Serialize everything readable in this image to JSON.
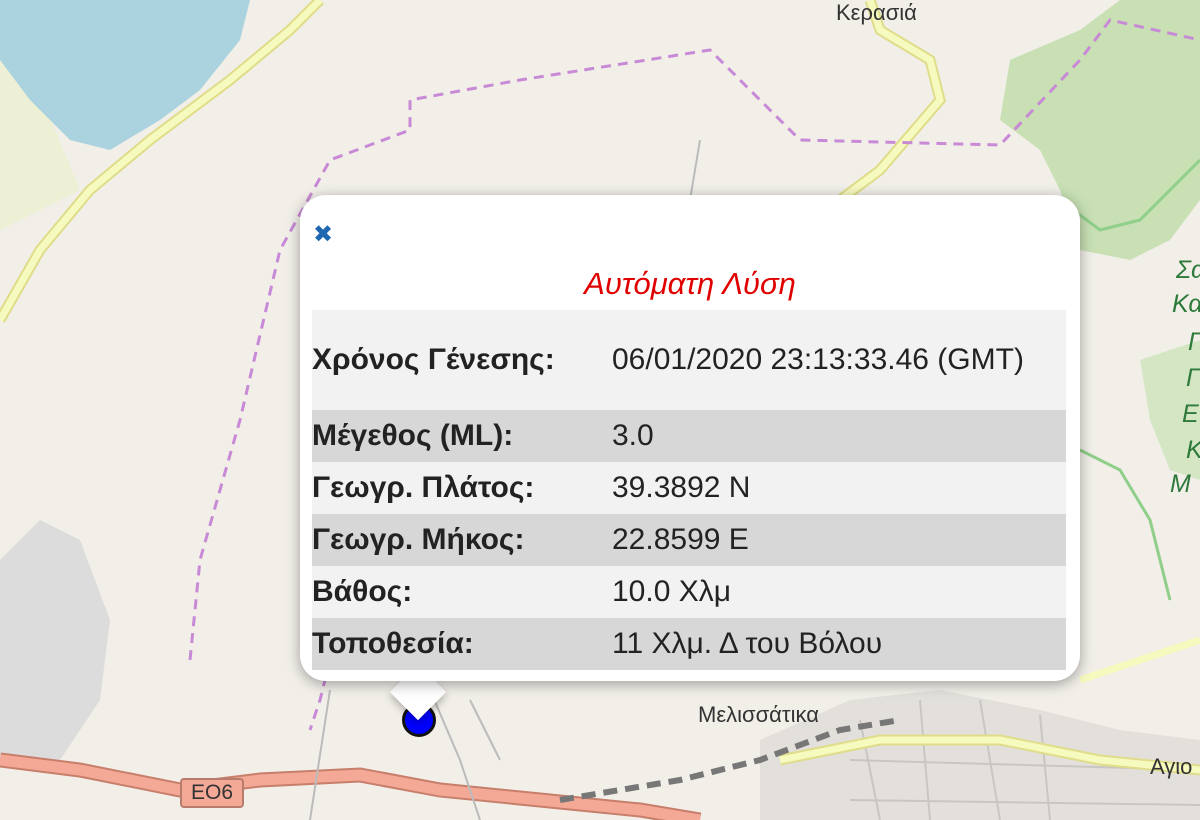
{
  "map": {
    "place_labels": {
      "kerasia": "Κερασιά",
      "melissatika": "Μελισσάτικα",
      "agi": "Αγιο"
    },
    "green_labels": [
      "Σα",
      "Κα",
      "Γ",
      "Γ",
      "Ε",
      "Κ",
      "Μ"
    ],
    "road_shield": "EO6",
    "colors": {
      "land": "#f2efe9",
      "water": "#aad3df",
      "forest": "#c8e0b4",
      "major_road": "#f7fabf",
      "motorway": "#f3a996",
      "boundary": "#c88ad6",
      "marker": "#0000ff"
    }
  },
  "popup": {
    "close_symbol": "✖",
    "title": "Αυτόματη Λύση",
    "title_color": "#e00000",
    "rows": [
      {
        "key": "Χρόνος Γένεσης:",
        "value": "06/01/2020 23:13:33.46 (GMT)"
      },
      {
        "key": "Μέγεθος (ML):",
        "value": "3.0"
      },
      {
        "key": "Γεωγρ. Πλάτος:",
        "value": "39.3892 N"
      },
      {
        "key": "Γεωγρ. Μήκος:",
        "value": "22.8599 E"
      },
      {
        "key": "Βάθος:",
        "value": "10.0 Χλμ"
      },
      {
        "key": "Τοποθεσία:",
        "value": "11 Χλμ. Δ του Βόλου"
      }
    ]
  }
}
